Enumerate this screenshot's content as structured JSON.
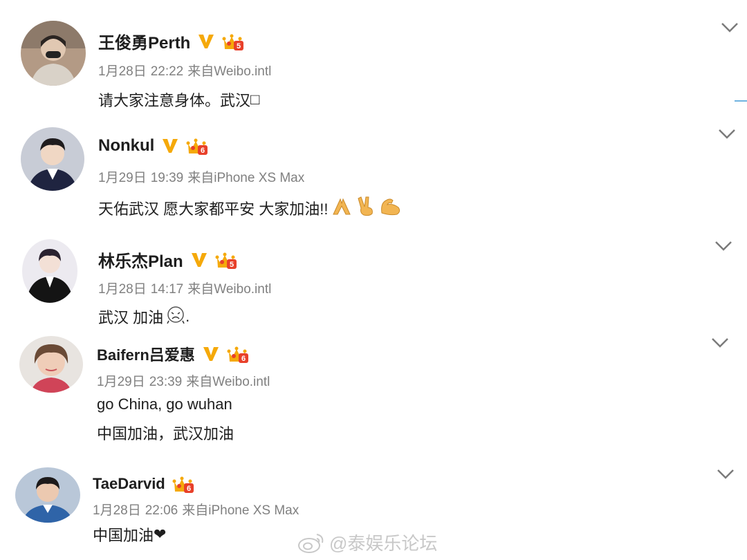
{
  "posts": [
    {
      "name": "王俊勇Perth",
      "date": "1月28日",
      "time": "22:22",
      "source_prefix": "来自",
      "source": "Weibo.intl",
      "text": "请大家注意身体。武汉",
      "text_cut": "□",
      "verified": true,
      "crown_level": "5"
    },
    {
      "name": "Nonkul",
      "date": "1月29日",
      "time": "19:39",
      "source_prefix": "来自",
      "source": "iPhone XS Max",
      "text": "天佑武汉 愿大家都平安 大家加油!!",
      "emojis": [
        "pray-emoji",
        "victory-hand-emoji",
        "flexed-biceps-emoji"
      ],
      "verified": true,
      "crown_level": "6"
    },
    {
      "name": "林乐杰Plan",
      "date": "1月28日",
      "time": "14:17",
      "source_prefix": "来自",
      "source": "Weibo.intl",
      "text": "武汉 加油",
      "trailing": ".",
      "emojis": [
        "crying-face-emoji"
      ],
      "verified": true,
      "crown_level": "5"
    },
    {
      "name": "Baifern吕爱惠",
      "date": "1月29日",
      "time": "23:39",
      "source_prefix": "来自",
      "source": "Weibo.intl",
      "text": "go China, go wuhan",
      "text2": "中国加油，武汉加油",
      "verified": true,
      "crown_level": "6"
    },
    {
      "name": "TaeDarvid",
      "date": "1月28日",
      "time": "22:06",
      "source_prefix": "来自",
      "source": "iPhone XS Max",
      "text": "中国加油",
      "heart": "❤",
      "verified": false,
      "crown_level": "6"
    }
  ],
  "watermark": "@泰娱乐论坛",
  "colors": {
    "gold": "#f5a90a",
    "crown_red": "#e8402a",
    "meta_gray": "#808080",
    "chevron": "#7a7a7a"
  }
}
